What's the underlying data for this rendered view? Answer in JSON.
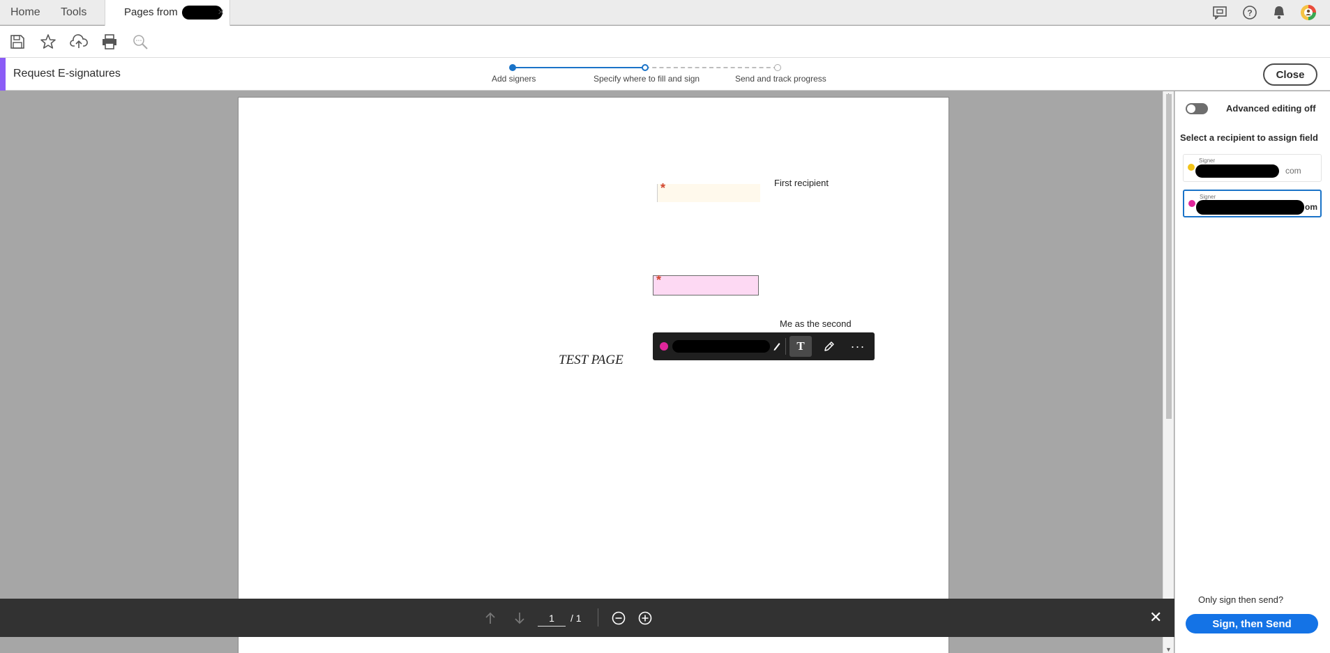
{
  "tabs": {
    "home": "Home",
    "tools": "Tools",
    "document": "Pages from",
    "close_glyph": "×"
  },
  "header_icons": [
    "messages-icon",
    "help-icon",
    "notifications-icon",
    "account-avatar"
  ],
  "toolbar_icons": [
    "save-icon",
    "bookmark-star-icon",
    "upload-cloud-icon",
    "print-icon",
    "zoom-search-icon"
  ],
  "request_bar": {
    "title": "Request E-signatures",
    "steps": [
      "Add signers",
      "Specify where to fill and sign",
      "Send and track progress"
    ],
    "close_label": "Close"
  },
  "document": {
    "note_first": "First recipient",
    "note_second": "Me as the second recipient",
    "test_page": "TEST PAGE",
    "required_star": "*"
  },
  "field_toolbar": {
    "text_tool": "T",
    "more": "···"
  },
  "bottom_nav": {
    "current_page": "1",
    "total_pages": "/ 1",
    "close_glyph": "✕"
  },
  "right_panel": {
    "advanced_editing": "Advanced editing off",
    "select_prompt": "Select a recipient to assign field",
    "recipients": [
      {
        "role": "Signer",
        "email_tail": "com",
        "color": "#f2c318"
      },
      {
        "role": "Signer",
        "email_tail": "om",
        "color": "#e0269b"
      }
    ],
    "only_sign": "Only sign then send?",
    "sign_button": "Sign, then Send"
  },
  "colors": {
    "accent_purple": "#8b5cf6",
    "primary_blue": "#1473e6",
    "signer2_pink": "#e0269b",
    "signer1_yellow": "#f2c318"
  }
}
